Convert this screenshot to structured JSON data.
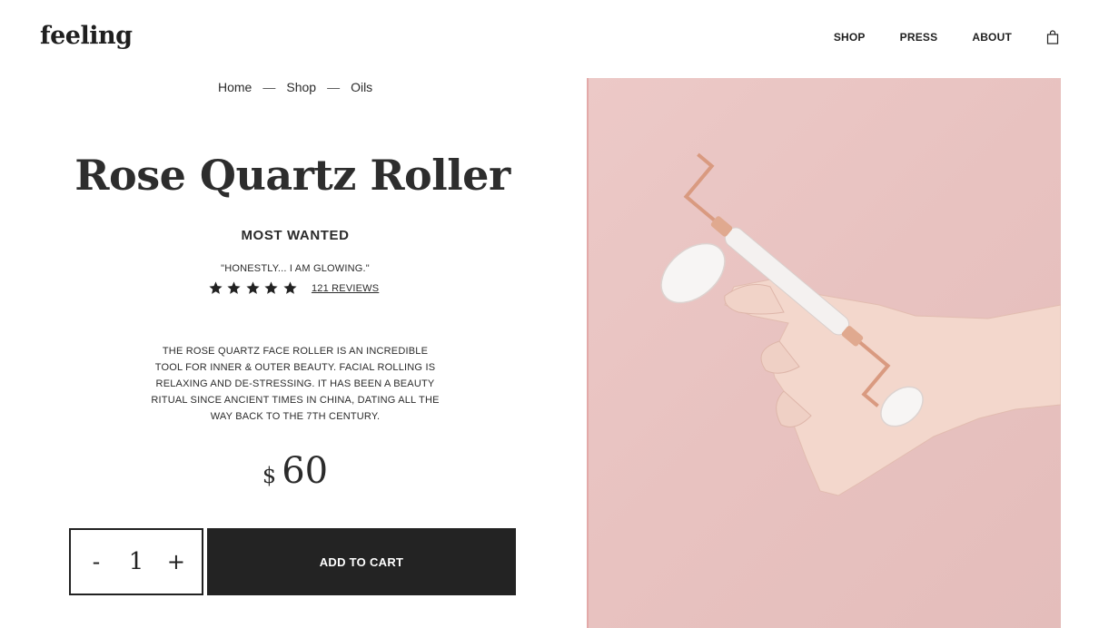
{
  "header": {
    "logo": "feeling",
    "nav": [
      "SHOP",
      "PRESS",
      "ABOUT"
    ],
    "cart_icon": "shopping-bag-icon"
  },
  "breadcrumb": {
    "items": [
      "Home",
      "Shop",
      "Oils"
    ],
    "separator": "—"
  },
  "product": {
    "title": "Rose Quartz Roller",
    "subtitle": "MOST WANTED",
    "quote": "\"HONESTLY... I AM GLOWING.\"",
    "rating": 5,
    "reviews_label": "121 REVIEWS",
    "description": "THE ROSE QUARTZ FACE ROLLER IS AN INCREDIBLE TOOL FOR INNER & OUTER BEAUTY. FACIAL ROLLING IS RELAXING AND DE-STRESSING. IT HAS BEEN A BEAUTY RITUAL SINCE ANCIENT TIMES IN CHINA, DATING ALL THE WAY BACK TO THE 7TH CENTURY.",
    "currency": "$",
    "price": "60",
    "image": "hand-holding-rose-quartz-roller"
  },
  "purchase": {
    "decrement_label": "-",
    "quantity": "1",
    "increment_label": "+",
    "add_to_cart_label": "ADD TO CART"
  },
  "colors": {
    "text": "#2b2b2b",
    "button_bg": "#232323",
    "image_bg": "#e8c2c0"
  }
}
